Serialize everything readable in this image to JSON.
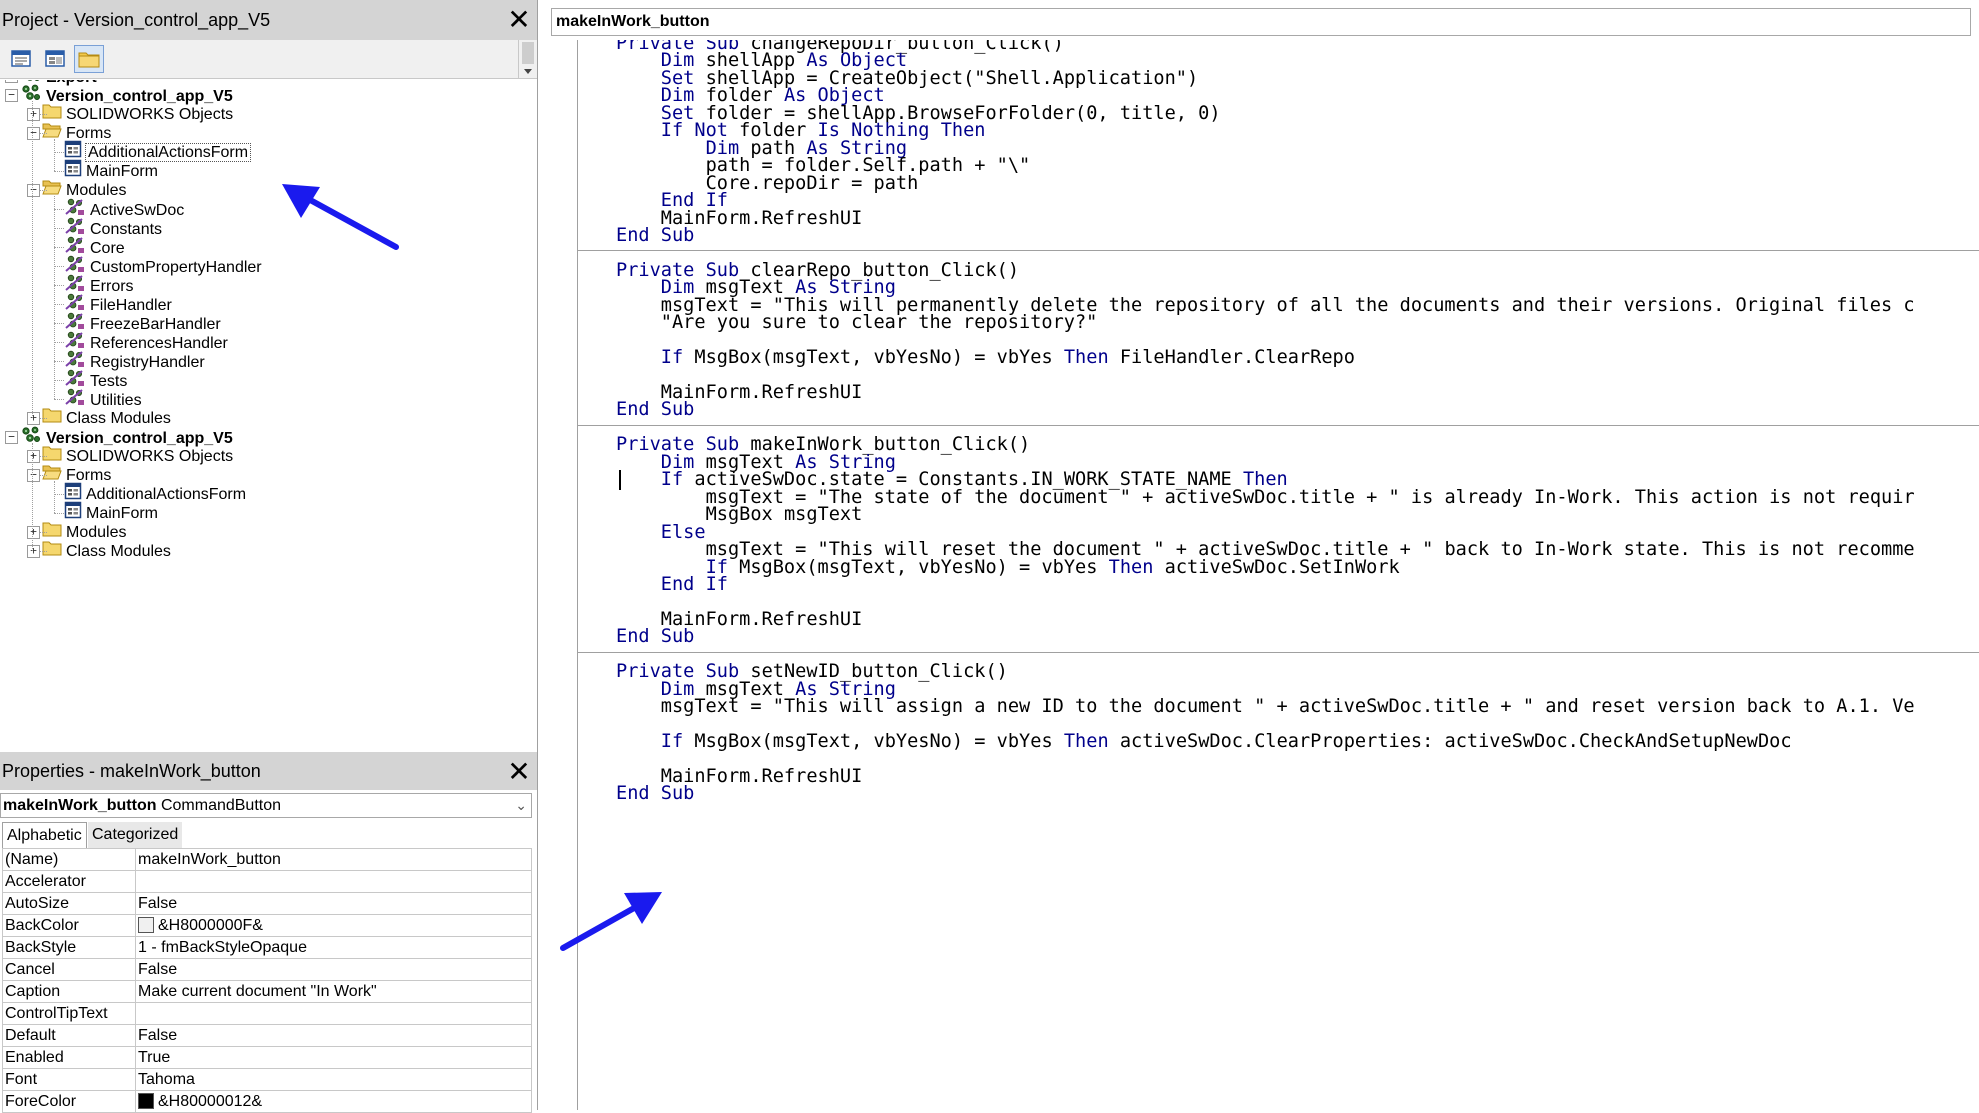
{
  "project_panel": {
    "title": "Project - Version_control_app_V5",
    "close_glyph": "✕",
    "tree": [
      {
        "label": "Export",
        "level": 0,
        "expander": "+",
        "icon": "project-icon",
        "bold": true
      },
      {
        "label": "Version_control_app_V5",
        "level": 0,
        "expander": "-",
        "icon": "project-icon",
        "bold": true
      },
      {
        "label": "SOLIDWORKS Objects",
        "level": 1,
        "expander": "+",
        "icon": "folder-icon",
        "bold": false
      },
      {
        "label": "Forms",
        "level": 1,
        "expander": "-",
        "icon": "folder-open-icon",
        "bold": false
      },
      {
        "label": "AdditionalActionsForm",
        "level": 2,
        "expander": "",
        "icon": "form-icon",
        "bold": false,
        "selected": true
      },
      {
        "label": "MainForm",
        "level": 2,
        "expander": "",
        "icon": "form-icon",
        "bold": false
      },
      {
        "label": "Modules",
        "level": 1,
        "expander": "-",
        "icon": "folder-open-icon",
        "bold": false
      },
      {
        "label": "ActiveSwDoc",
        "level": 2,
        "expander": "",
        "icon": "module-icon",
        "bold": false
      },
      {
        "label": "Constants",
        "level": 2,
        "expander": "",
        "icon": "module-icon",
        "bold": false
      },
      {
        "label": "Core",
        "level": 2,
        "expander": "",
        "icon": "module-icon",
        "bold": false
      },
      {
        "label": "CustomPropertyHandler",
        "level": 2,
        "expander": "",
        "icon": "module-icon",
        "bold": false
      },
      {
        "label": "Errors",
        "level": 2,
        "expander": "",
        "icon": "module-icon",
        "bold": false
      },
      {
        "label": "FileHandler",
        "level": 2,
        "expander": "",
        "icon": "module-icon",
        "bold": false
      },
      {
        "label": "FreezeBarHandler",
        "level": 2,
        "expander": "",
        "icon": "module-icon",
        "bold": false
      },
      {
        "label": "ReferencesHandler",
        "level": 2,
        "expander": "",
        "icon": "module-icon",
        "bold": false
      },
      {
        "label": "RegistryHandler",
        "level": 2,
        "expander": "",
        "icon": "module-icon",
        "bold": false
      },
      {
        "label": "Tests",
        "level": 2,
        "expander": "",
        "icon": "module-icon",
        "bold": false
      },
      {
        "label": "Utilities",
        "level": 2,
        "expander": "",
        "icon": "module-icon",
        "bold": false
      },
      {
        "label": "Class Modules",
        "level": 1,
        "expander": "+",
        "icon": "folder-icon",
        "bold": false
      },
      {
        "label": "Version_control_app_V5",
        "level": 0,
        "expander": "-",
        "icon": "project-icon",
        "bold": true
      },
      {
        "label": "SOLIDWORKS Objects",
        "level": 1,
        "expander": "+",
        "icon": "folder-icon",
        "bold": false
      },
      {
        "label": "Forms",
        "level": 1,
        "expander": "-",
        "icon": "folder-open-icon",
        "bold": false
      },
      {
        "label": "AdditionalActionsForm",
        "level": 2,
        "expander": "",
        "icon": "form-icon",
        "bold": false
      },
      {
        "label": "MainForm",
        "level": 2,
        "expander": "",
        "icon": "form-icon",
        "bold": false
      },
      {
        "label": "Modules",
        "level": 1,
        "expander": "+",
        "icon": "folder-icon",
        "bold": false
      },
      {
        "label": "Class Modules",
        "level": 1,
        "expander": "+",
        "icon": "folder-icon",
        "bold": false
      }
    ]
  },
  "properties_panel": {
    "title": "Properties - makeInWork_button",
    "close_glyph": "✕",
    "object_name": "makeInWork_button",
    "object_type": "CommandButton",
    "tabs": [
      "Alphabetic",
      "Categorized"
    ],
    "active_tab": "Alphabetic",
    "rows": [
      {
        "name": "(Name)",
        "value": "makeInWork_button"
      },
      {
        "name": "Accelerator",
        "value": ""
      },
      {
        "name": "AutoSize",
        "value": "False"
      },
      {
        "name": "BackColor",
        "value": "&H8000000F&",
        "swatch": "#f0f0f0"
      },
      {
        "name": "BackStyle",
        "value": "1 - fmBackStyleOpaque"
      },
      {
        "name": "Cancel",
        "value": "False"
      },
      {
        "name": "Caption",
        "value": "Make current document \"In Work\""
      },
      {
        "name": "ControlTipText",
        "value": ""
      },
      {
        "name": "Default",
        "value": "False"
      },
      {
        "name": "Enabled",
        "value": "True"
      },
      {
        "name": "Font",
        "value": "Tahoma"
      },
      {
        "name": "ForeColor",
        "value": "&H80000012&",
        "swatch": "#000000"
      }
    ]
  },
  "code_window": {
    "procedure_combo": "makeInWork_button",
    "keyword_color": "#00008b",
    "procedures": [
      {
        "lines": [
          "Private Sub changeRepoDir_button_Click()",
          "    Dim shellApp As Object",
          "    Set shellApp = CreateObject(\"Shell.Application\")",
          "    Dim folder As Object",
          "    Set folder = shellApp.BrowseForFolder(0, title, 0)",
          "    If Not folder Is Nothing Then",
          "        Dim path As String",
          "        path = folder.Self.path + \"\\\"",
          "        Core.repoDir = path",
          "    End If",
          "    MainForm.RefreshUI",
          "End Sub"
        ]
      },
      {
        "lines": [
          "Private Sub clearRepo_button_Click()",
          "    Dim msgText As String",
          "    msgText = \"This will permanently delete the repository of all the documents and their versions. Original files c",
          "    \"Are you sure to clear the repository?\"",
          "",
          "    If MsgBox(msgText, vbYesNo) = vbYes Then FileHandler.ClearRepo",
          "",
          "    MainForm.RefreshUI",
          "End Sub"
        ]
      },
      {
        "lines": [
          "Private Sub makeInWork_button_Click()",
          "    Dim msgText As String",
          "    If activeSwDoc.state = Constants.IN_WORK_STATE_NAME Then",
          "        msgText = \"The state of the document \" + activeSwDoc.title + \" is already In-Work. This action is not requir",
          "        MsgBox msgText",
          "    Else",
          "        msgText = \"This will reset the document \" + activeSwDoc.title + \" back to In-Work state. This is not recomme",
          "        If MsgBox(msgText, vbYesNo) = vbYes Then activeSwDoc.SetInWork",
          "    End If",
          "",
          "    MainForm.RefreshUI",
          "End Sub"
        ]
      },
      {
        "lines": [
          "Private Sub setNewID_button_Click()",
          "    Dim msgText As String",
          "    msgText = \"This will assign a new ID to the document \" + activeSwDoc.title + \" and reset version back to A.1. Ve",
          "",
          "    If MsgBox(msgText, vbYesNo) = vbYes Then activeSwDoc.ClearProperties: activeSwDoc.CheckAndSetupNewDoc",
          "",
          "    MainForm.RefreshUI",
          "End Sub"
        ]
      }
    ]
  },
  "annotation_color": "#1a1aee"
}
